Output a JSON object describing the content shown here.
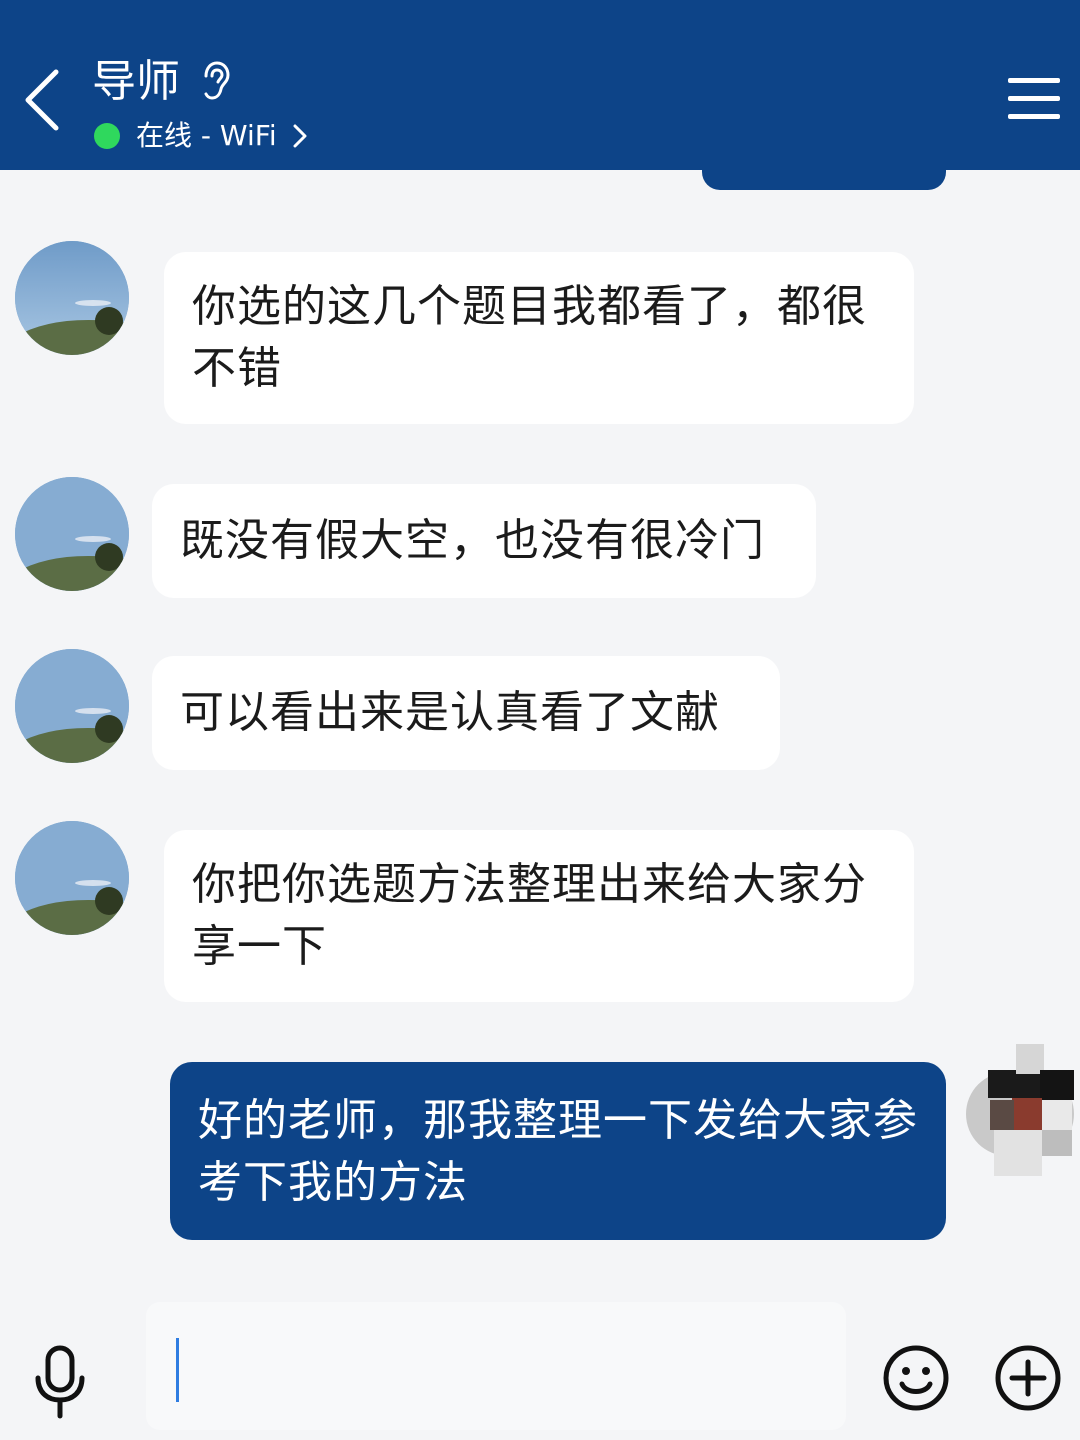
{
  "header": {
    "title": "导师",
    "status": "在线 - WiFi"
  },
  "messages": [
    {
      "sender": "导师",
      "direction": "incoming",
      "text": "你选的这几个题目我都看了，都很不错"
    },
    {
      "sender": "导师",
      "direction": "incoming",
      "text": "既没有假大空，也没有很冷门"
    },
    {
      "sender": "导师",
      "direction": "incoming",
      "text": "可以看出来是认真看了文献"
    },
    {
      "sender": "导师",
      "direction": "incoming",
      "text": "你把你选题方法整理出来给大家分享一下"
    },
    {
      "sender": "self",
      "direction": "outgoing",
      "text": "好的老师，那我整理一下发给大家参考下我的方法"
    }
  ],
  "input": {
    "value": ""
  },
  "icons": {
    "back": "chevron-left-icon",
    "hearing": "ear-icon",
    "status_chevron": "chevron-right-icon",
    "menu": "hamburger-menu-icon",
    "mic": "microphone-icon",
    "emoji": "smiley-icon",
    "plus": "plus-circle-icon"
  },
  "colors": {
    "header": "#0d4488",
    "online": "#2fd85d",
    "outgoing_bubble": "#0d4488",
    "incoming_bubble": "#ffffff",
    "background": "#f4f5f7",
    "caret": "#2f7de1"
  }
}
